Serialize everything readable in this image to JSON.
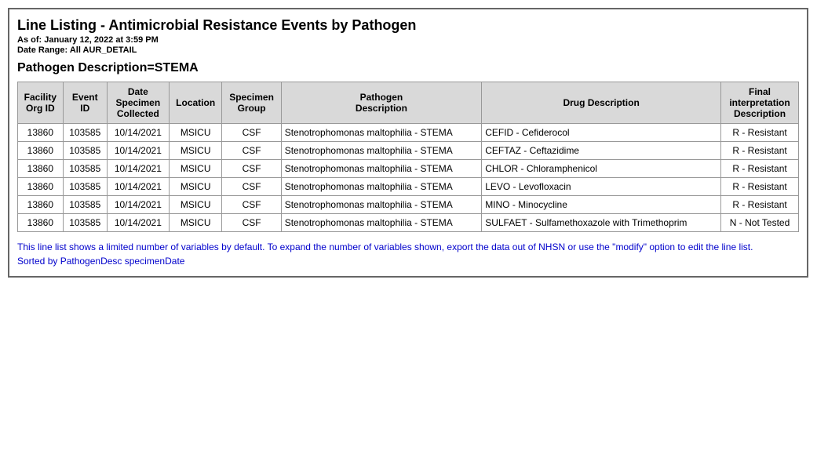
{
  "report": {
    "title": "Line Listing - Antimicrobial Resistance Events by Pathogen",
    "as_of": "As of: January 12, 2022 at 3:59 PM",
    "date_range": "Date Range: All AUR_DETAIL",
    "filter_heading": "Pathogen Description=STEMA"
  },
  "table": {
    "headers": [
      "Facility Org ID",
      "Event ID",
      "Date Specimen Collected",
      "Location",
      "Specimen Group",
      "Pathogen Description",
      "Drug Description",
      "Final interpretation Description"
    ],
    "rows": [
      {
        "facility_org_id": "13860",
        "event_id": "103585",
        "date_collected": "10/14/2021",
        "location": "MSICU",
        "specimen_group": "CSF",
        "pathogen_description": "Stenotrophomonas maltophilia - STEMA",
        "drug_description": "CEFID - Cefiderocol",
        "final_interpretation": "R - Resistant"
      },
      {
        "facility_org_id": "13860",
        "event_id": "103585",
        "date_collected": "10/14/2021",
        "location": "MSICU",
        "specimen_group": "CSF",
        "pathogen_description": "Stenotrophomonas maltophilia - STEMA",
        "drug_description": "CEFTAZ - Ceftazidime",
        "final_interpretation": "R - Resistant"
      },
      {
        "facility_org_id": "13860",
        "event_id": "103585",
        "date_collected": "10/14/2021",
        "location": "MSICU",
        "specimen_group": "CSF",
        "pathogen_description": "Stenotrophomonas maltophilia - STEMA",
        "drug_description": "CHLOR - Chloramphenicol",
        "final_interpretation": "R - Resistant"
      },
      {
        "facility_org_id": "13860",
        "event_id": "103585",
        "date_collected": "10/14/2021",
        "location": "MSICU",
        "specimen_group": "CSF",
        "pathogen_description": "Stenotrophomonas maltophilia - STEMA",
        "drug_description": "LEVO - Levofloxacin",
        "final_interpretation": "R - Resistant"
      },
      {
        "facility_org_id": "13860",
        "event_id": "103585",
        "date_collected": "10/14/2021",
        "location": "MSICU",
        "specimen_group": "CSF",
        "pathogen_description": "Stenotrophomonas maltophilia - STEMA",
        "drug_description": "MINO - Minocycline",
        "final_interpretation": "R - Resistant"
      },
      {
        "facility_org_id": "13860",
        "event_id": "103585",
        "date_collected": "10/14/2021",
        "location": "MSICU",
        "specimen_group": "CSF",
        "pathogen_description": "Stenotrophomonas maltophilia - STEMA",
        "drug_description": "SULFAET - Sulfamethoxazole with Trimethoprim",
        "final_interpretation": "N - Not Tested"
      }
    ]
  },
  "footer": {
    "note": "This line list shows a limited number of variables by default. To expand the number of variables shown, export the data out of NHSN or use the \"modify\" option to edit the line list.",
    "sorted_by": "Sorted by PathogenDesc specimenDate"
  }
}
